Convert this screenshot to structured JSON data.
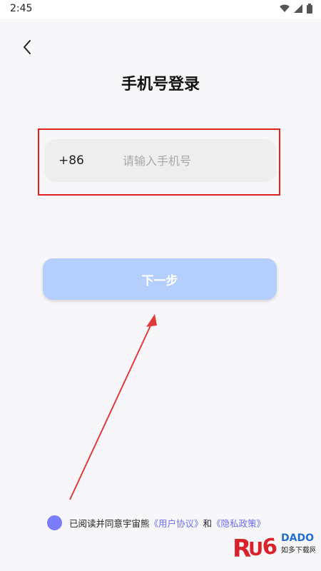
{
  "status_bar": {
    "time": "2:45",
    "icons": [
      "wifi-icon",
      "signal-icon",
      "battery-icon"
    ]
  },
  "header": {
    "back_icon": "chevron-left-icon",
    "title": "手机号登录"
  },
  "phone_field": {
    "country_code": "+86",
    "value": "",
    "placeholder": "请输入手机号"
  },
  "next_button": {
    "label": "下一步"
  },
  "agreement": {
    "text": "已阅读并同意宇宙熊",
    "user_agreement": "《用户协议》",
    "and": "和",
    "privacy_policy": "《隐私政策》"
  },
  "watermark": {
    "logo_text": "RUANDADO",
    "sub_text": "如多下载网"
  },
  "colors": {
    "accent": "#7b7dff",
    "button_bg": "#b5cffd",
    "highlight": "#e02020",
    "link": "#6a6cf5"
  }
}
